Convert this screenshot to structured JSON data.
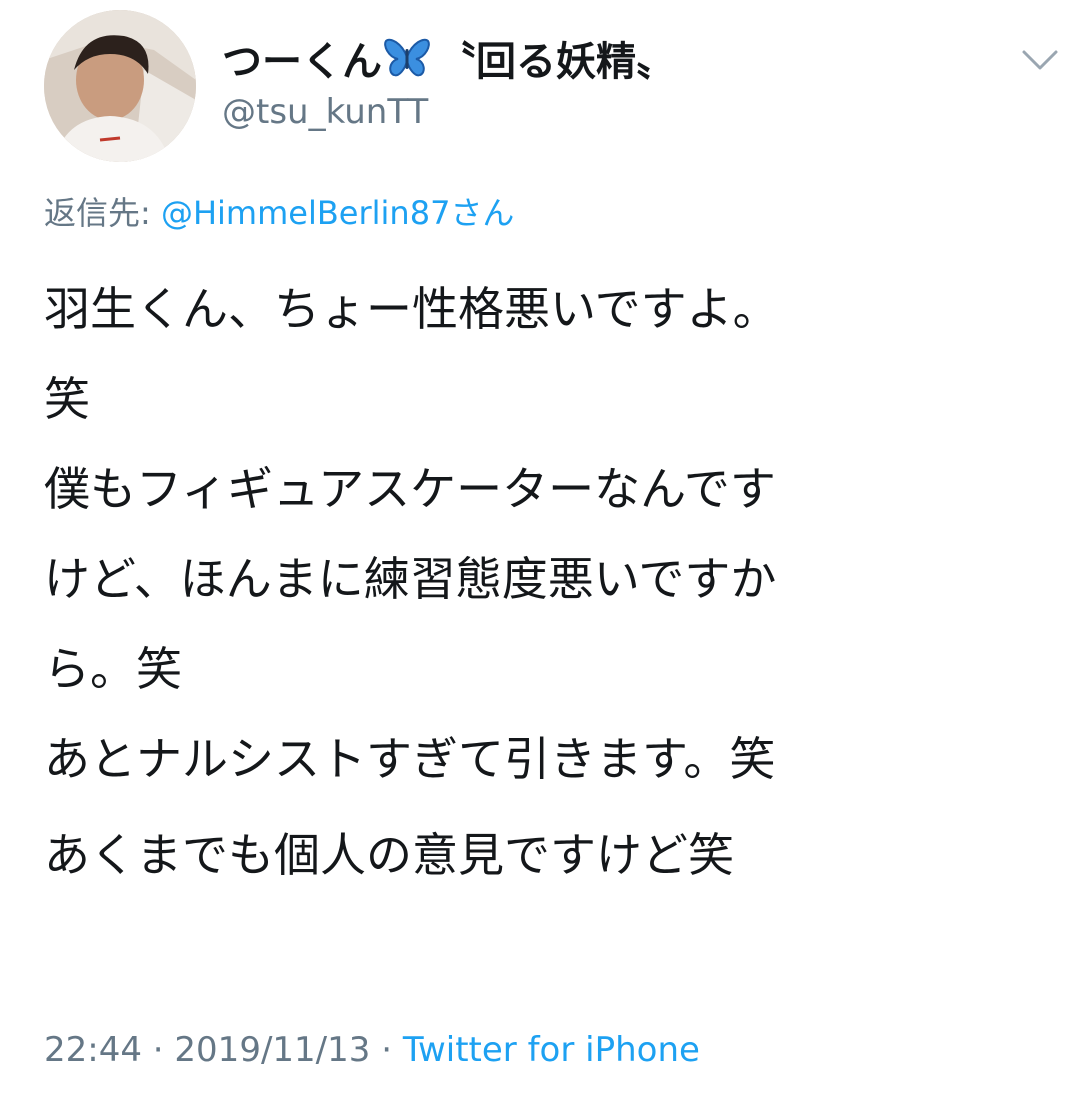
{
  "tweet": {
    "display_name_prefix": "つーくん",
    "display_name_suffix": "〝回る妖精〟",
    "handle": "@tsu_kunTT",
    "reply_prefix": "返信先: ",
    "reply_mention": "@HimmelBerlin87",
    "reply_suffix": "さん",
    "lines": [
      "羽生くん、ちょー性格悪いですよ。",
      "笑",
      "僕もフィギュアスケーターなんです",
      "けど、ほんまに練習態度悪いですか",
      "ら。笑",
      "あとナルシストすぎて引きます。笑",
      "あくまでも個人の意見ですけど笑"
    ],
    "time": "22:44",
    "separator": " · ",
    "date": "2019/11/13",
    "source": "Twitter for iPhone"
  },
  "icons": {
    "avatar": "profile-photo",
    "name_emoji": "butterfly-icon",
    "menu": "chevron-down-icon"
  },
  "colors": {
    "text": "#14171a",
    "secondary": "#657786",
    "link": "#1da1f2"
  }
}
